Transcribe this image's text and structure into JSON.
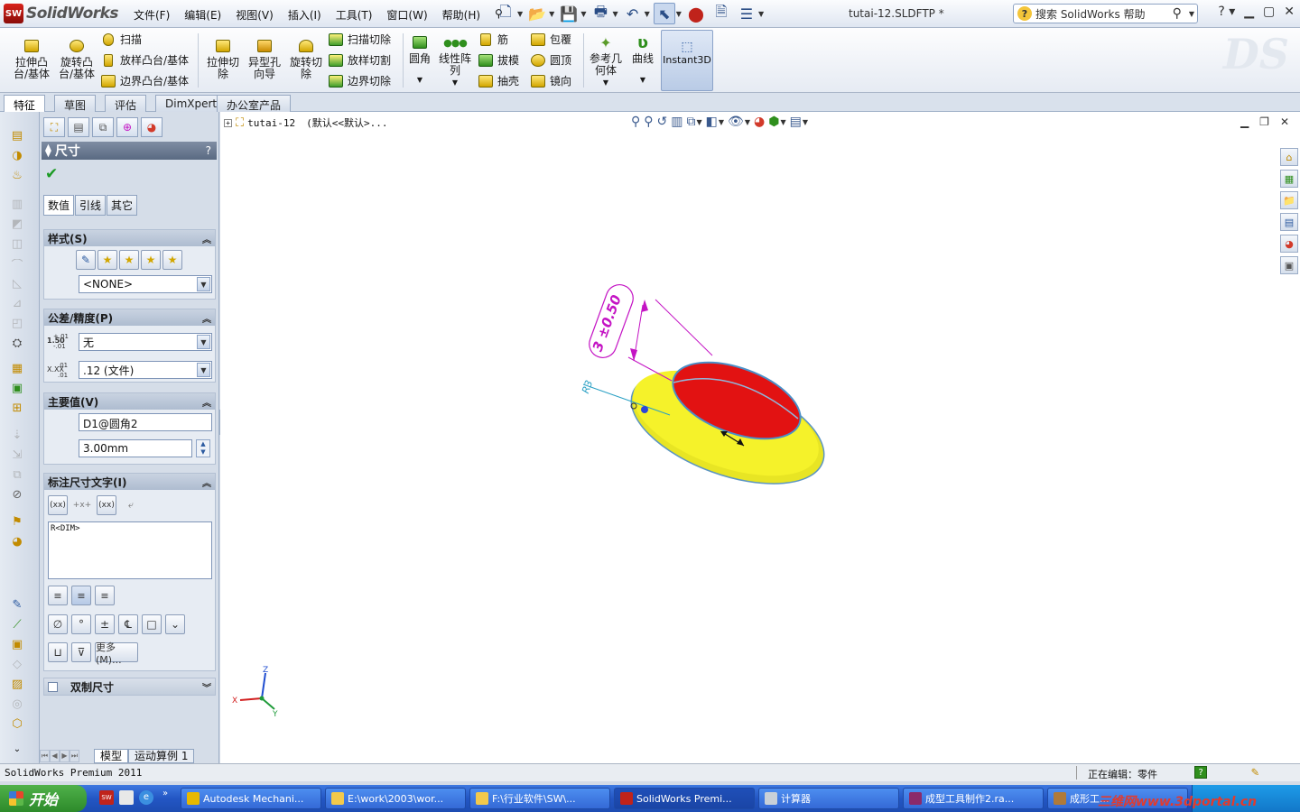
{
  "app": {
    "brand": "SolidWorks",
    "brand_mark": "SW",
    "document_title": "tutai-12.SLDFTP *"
  },
  "menu": [
    "文件(F)",
    "编辑(E)",
    "视图(V)",
    "插入(I)",
    "工具(T)",
    "窗口(W)",
    "帮助(H)"
  ],
  "help_search": {
    "placeholder": "搜索 SolidWorks 帮助"
  },
  "ribbon": {
    "big_buttons": [
      {
        "label1": "拉伸凸",
        "label2": "台/基体"
      },
      {
        "label1": "旋转凸",
        "label2": "台/基体"
      },
      {
        "label1": "拉伸切",
        "label2": "除"
      },
      {
        "label1": "异型孔",
        "label2": "向导"
      },
      {
        "label1": "旋转切",
        "label2": "除"
      },
      {
        "label1": "圆角",
        "label2": ""
      },
      {
        "label1": "线性阵",
        "label2": "列"
      },
      {
        "label1": "参考几",
        "label2": "何体"
      },
      {
        "label1": "曲线",
        "label2": ""
      }
    ],
    "small_buttons": {
      "sweep": "扫描",
      "loft": "放样凸台/基体",
      "boundary_boss": "边界凸台/基体",
      "sweep_cut": "扫描切除",
      "loft_cut": "放样切割",
      "boundary_cut": "边界切除",
      "rib": "筋",
      "draft": "拔模",
      "shell": "抽壳",
      "wrap": "包覆",
      "dome": "圆顶",
      "mirror": "镜向"
    },
    "instant3d": "Instant3D"
  },
  "command_tabs": [
    "特征",
    "草图",
    "评估",
    "DimXpert",
    "办公室产品"
  ],
  "property_manager": {
    "title": "尺寸",
    "help": "?",
    "subtabs": [
      "数值",
      "引线",
      "其它"
    ],
    "style_group": {
      "title": "样式(S)",
      "style_value": "<NONE>"
    },
    "tolerance_group": {
      "title": "公差/精度(P)",
      "tol_icon_text": "1.50",
      "tol_icon_sup": "+.01",
      "tol_icon_sub": "-.01",
      "prec_icon_text": "X.XX",
      "prec_icon_sup": ".01",
      "prec_icon_sub": ".01",
      "tolerance_type": "无",
      "precision": ".12 (文件)"
    },
    "primary_value_group": {
      "title": "主要值(V)",
      "name": "D1@圆角2",
      "value": "3.00mm"
    },
    "dim_text_group": {
      "title": "标注尺寸文字(I)",
      "text": "R<DIM>",
      "more_button": "更多(M)..."
    },
    "dual_dim_group": {
      "title": "双制尺寸"
    },
    "bottom_tabs": [
      "模型",
      "运动算例 1"
    ]
  },
  "viewport": {
    "tree_root_name": "tutai-12",
    "tree_root_config": "(默认<<默认>...",
    "dim_tolerance_label": "3 ±0.50",
    "radius_label": "R3",
    "triad": {
      "x": "X",
      "y": "Y",
      "z": "Z"
    },
    "colors": {
      "body": "#f2ef1e",
      "face": "#e81010",
      "edge": "#4a8fc8",
      "dim": "#c414c4",
      "radius_dim": "#2aa0c4"
    }
  },
  "status": {
    "product": "SolidWorks Premium 2011",
    "editing": "正在编辑：零件",
    "help_icon": "?"
  },
  "taskbar": {
    "start": "开始",
    "items": [
      "Autodesk Mechani...",
      "E:\\work\\2003\\wor...",
      "F:\\行业软件\\SW\\...",
      "SolidWorks Premi...",
      "计算器",
      "成型工具制作2.ra...",
      "成形工..."
    ],
    "watermark": "三维网www.3dportal.cn"
  }
}
